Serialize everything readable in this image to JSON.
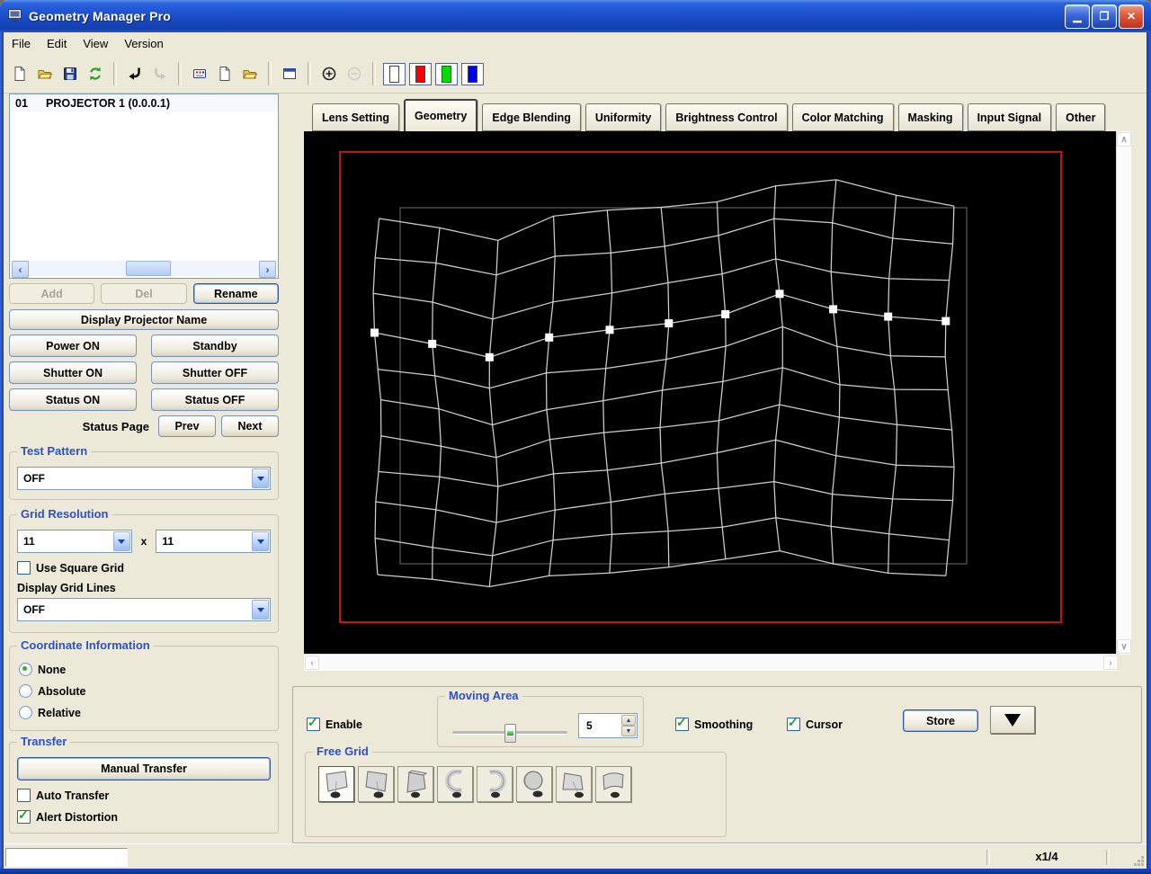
{
  "window": {
    "title": "Geometry Manager Pro"
  },
  "menu_bar": {
    "items": [
      "File",
      "Edit",
      "View",
      "Version"
    ]
  },
  "toolbar": {
    "buttons": [
      {
        "name": "new-file-icon"
      },
      {
        "name": "open-file-icon"
      },
      {
        "name": "save-icon"
      },
      {
        "name": "refresh-icon"
      },
      {
        "name": "sep"
      },
      {
        "name": "undo-icon"
      },
      {
        "name": "redo-icon",
        "disabled": true
      },
      {
        "name": "sep"
      },
      {
        "name": "remote-icon"
      },
      {
        "name": "new-page-icon"
      },
      {
        "name": "open-folder-icon"
      },
      {
        "name": "sep"
      },
      {
        "name": "window-icon"
      },
      {
        "name": "sep"
      },
      {
        "name": "zoom-in-icon"
      },
      {
        "name": "zoom-out-icon",
        "disabled": true
      },
      {
        "name": "sep"
      },
      {
        "name": "white-swatch",
        "color": "#ffffff"
      },
      {
        "name": "red-swatch",
        "color": "#fe0000"
      },
      {
        "name": "green-swatch",
        "color": "#00dd00"
      },
      {
        "name": "blue-swatch",
        "color": "#0000ee"
      }
    ]
  },
  "projector_list": {
    "rows": [
      {
        "id": "01",
        "name": "PROJECTOR 1 (0.0.0.1)"
      }
    ]
  },
  "left_panel": {
    "add": "Add",
    "del": "Del",
    "rename": "Rename",
    "display_projector_name": "Display Projector Name",
    "power_on": "Power ON",
    "standby": "Standby",
    "shutter_on": "Shutter ON",
    "shutter_off": "Shutter OFF",
    "status_on": "Status ON",
    "status_off": "Status OFF",
    "status_page": "Status Page",
    "prev": "Prev",
    "next": "Next",
    "test_pattern": {
      "label": "Test Pattern",
      "value": "OFF"
    },
    "grid_resolution": {
      "label": "Grid Resolution",
      "h": "11",
      "times": "x",
      "v": "11",
      "use_square_grid": "Use Square Grid",
      "use_square_grid_checked": false,
      "display_grid_lines": "Display Grid Lines",
      "display_grid_lines_value": "OFF"
    },
    "coordinate_information": {
      "label": "Coordinate Information",
      "options": [
        "None",
        "Absolute",
        "Relative"
      ],
      "selected_index": 0
    },
    "transfer": {
      "label": "Transfer",
      "manual": "Manual Transfer",
      "auto": "Auto Transfer",
      "auto_checked": false,
      "alert": "Alert Distortion",
      "alert_checked": true
    }
  },
  "tabs": {
    "items": [
      "Lens Setting",
      "Geometry",
      "Edge Blending",
      "Uniformity",
      "Brightness Control",
      "Color Matching",
      "Masking",
      "Input Signal",
      "Other"
    ],
    "active": "Geometry"
  },
  "canvas": {
    "grid_cols": 11,
    "grid_rows": 11,
    "handle_row_index": 3,
    "top_offsets_y": [
      2,
      10,
      25,
      1,
      -5,
      -11,
      -19,
      -35,
      -39,
      -22,
      -13
    ],
    "handle_offsets_y": [
      12,
      22,
      38,
      19,
      11,
      1,
      -11,
      -32,
      -12,
      -4,
      -2
    ],
    "bottom_offsets_y": [
      6,
      14,
      24,
      10,
      4,
      -2,
      -8,
      -16,
      -4,
      4,
      8
    ],
    "colors": {
      "background": "#000000",
      "outer_border": "#c81010",
      "reference": "#4f4f4f",
      "mesh": "#d9d9d9",
      "handle": "#ffffff"
    }
  },
  "bottom_panel": {
    "enable": "Enable",
    "enable_checked": true,
    "moving_area": {
      "label": "Moving Area",
      "value": "5"
    },
    "smoothing": "Smoothing",
    "smoothing_checked": true,
    "cursor": "Cursor",
    "cursor_checked": true,
    "store": "Store",
    "free_grid": {
      "label": "Free Grid",
      "icons": [
        "screen-flat-left-icon",
        "screen-flat-right-icon",
        "screen-tilt-icon",
        "cylinder-concave-icon",
        "cylinder-convex-icon",
        "sphere-icon",
        "screen-angle-icon",
        "screen-curve-icon"
      ],
      "selected_index": 0
    }
  },
  "status_bar": {
    "scale": "x1/4"
  }
}
